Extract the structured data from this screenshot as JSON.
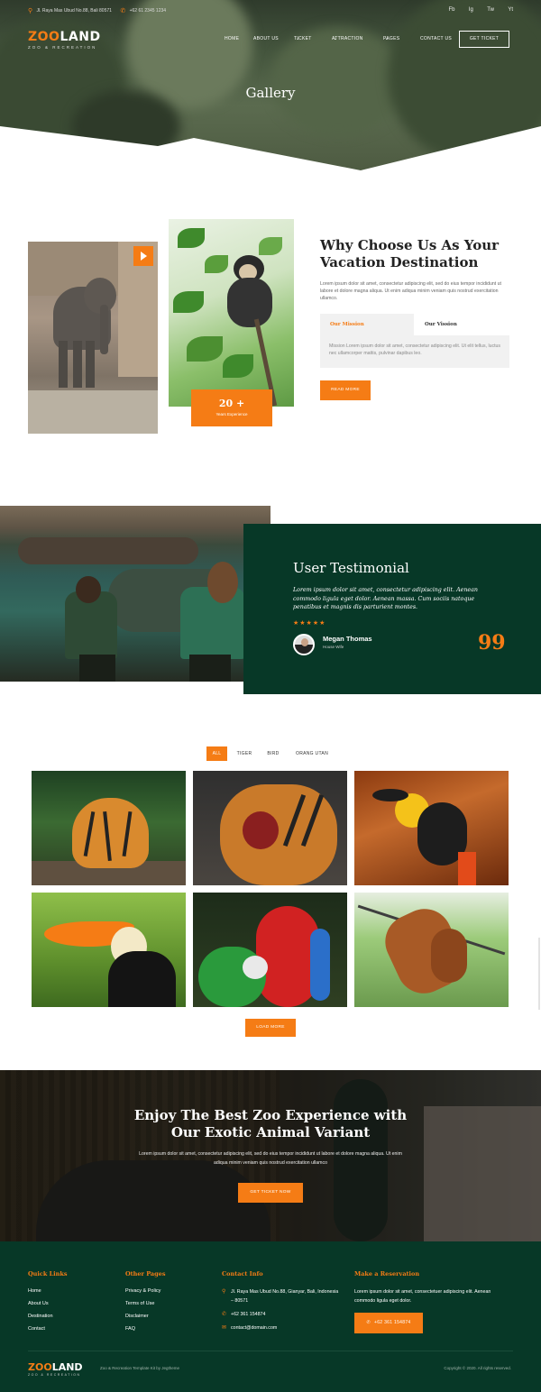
{
  "topbar": {
    "address": "Jl. Raya Mas Ubud No.88, Bali 80571",
    "phone": "+62 61 2345 1234",
    "socials": [
      "Fb",
      "Ig",
      "Tw",
      "Yt"
    ]
  },
  "brand": {
    "logo_text_a": "ZOO",
    "logo_text_b": "LAND",
    "tagline": "ZOO & RECREATION",
    "accent": "#f57c15",
    "dark": "#073827"
  },
  "nav": {
    "items": [
      "HOME",
      "ABOUT US",
      "TICKET",
      "ATTRACTION",
      "PAGES",
      "CONTACT US"
    ],
    "cta": "GET TICKET"
  },
  "hero": {
    "title": "Gallery"
  },
  "about": {
    "title_line1": "Why Choose Us As Your",
    "title_line2": "Vacation Destination",
    "description": "Lorem ipsum dolor sit amet, consectetur adipiscing elit, sed do eius tempor incididunt ut labore et dolore magna aliqua. Ut enim adiqua minim veniam quis nostrud exercitation ullamco.",
    "experience_number": "20 +",
    "experience_label": "Years Experience",
    "tabs": [
      "Our Mission",
      "Our Vission"
    ],
    "tab_content": "Mission Lorem ipsum dolor sit amet, consectetur adipiscing elit. Ut elit tellus, luctus nec ullamcorper mattis, pulvinar dapibus leo.",
    "button": "READ MORE"
  },
  "testimonial": {
    "title": "User Testimonial",
    "quote": "Lorem ipsum dolor sit amet, consectetur adipiscing elit. Aenean commodo ligula eget dolor. Aenean massa. Cum sociis natoque penatibus et magnis dis parturient montes.",
    "rating": 5,
    "stars": "★★★★★",
    "name": "Megan Thomas",
    "role": "House Wife",
    "quote_mark": "99"
  },
  "gallery": {
    "filters": [
      "ALL",
      "TIGER",
      "BIRD",
      "ORANG UTAN"
    ],
    "active_filter": "ALL",
    "button": "LOAD MORE"
  },
  "cta": {
    "title_line1": "Enjoy The Best Zoo Experience with",
    "title_line2": "Our Exotic Animal Variant",
    "description": "Lorem ipsum dolor sit amet, consectetur adipiscing elit, sed do eius tempor incididunt ut labore et dolore magna aliqua. Ut enim adiqua minim veniam quis nostrud exercitation ullamco",
    "button": "GET TICKET NOW"
  },
  "footer": {
    "quick_links_title": "Quick Links",
    "quick_links": [
      "Home",
      "About Us",
      "Destination",
      "Contact"
    ],
    "other_pages_title": "Other Pages",
    "other_pages": [
      "Privacy & Policy",
      "Terms of Use",
      "Disclaimer",
      "FAQ"
    ],
    "contact_title": "Contact Info",
    "contact_address": "Jl. Raya Mas Ubud No.88, Gianyar, Bali, Indonesia – 80571",
    "contact_phone": "+62 361 154874",
    "contact_email": "contact@domain.com",
    "reservation_title": "Make a Reservation",
    "reservation_text": "Lorem ipsum dolor sit amet, consectetuer adipiscing elit. Aenean commodo ligula eget dolor.",
    "reservation_button": "+62 361 154874",
    "credit": "Zoo & Recreation Template Kit by Jegtheme",
    "copyright": "Copyright © 2020. All rights reserved."
  }
}
